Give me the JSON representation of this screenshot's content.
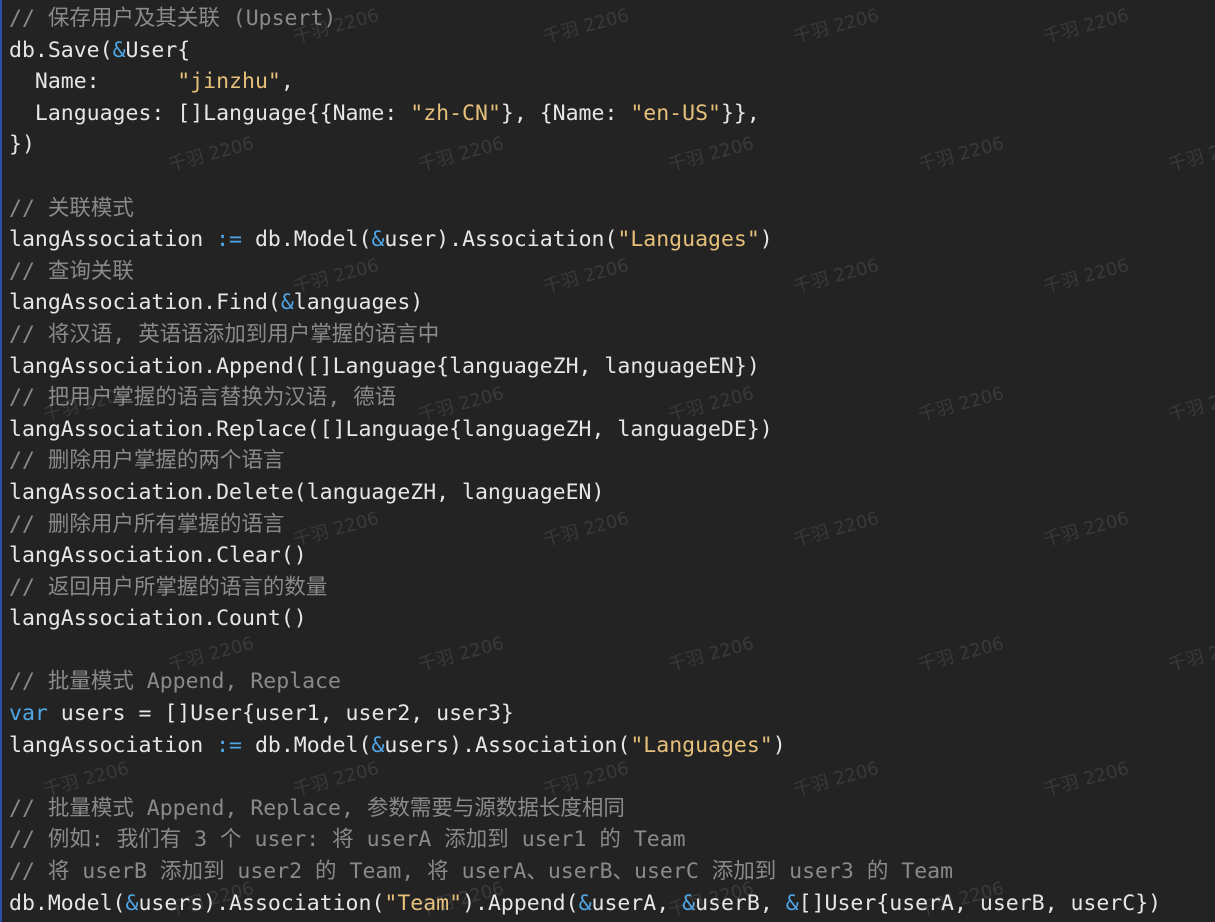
{
  "colors": {
    "background": "#232323",
    "comment": "#8a8a8a",
    "string": "#e6c07b",
    "keyword": "#4fa6e6",
    "text": "#e6e6e6"
  },
  "watermark_text": "千羽 2206",
  "lines": [
    [
      {
        "t": "// 保存用户及其关联 (Upsert)",
        "c": "comment"
      }
    ],
    [
      {
        "t": "db.Save(",
        "c": "plain"
      },
      {
        "t": "&",
        "c": "op"
      },
      {
        "t": "User{",
        "c": "plain"
      }
    ],
    [
      {
        "t": "  Name:      ",
        "c": "plain"
      },
      {
        "t": "\"jinzhu\"",
        "c": "string"
      },
      {
        "t": ",",
        "c": "plain"
      }
    ],
    [
      {
        "t": "  Languages: []Language{{Name: ",
        "c": "plain"
      },
      {
        "t": "\"zh-CN\"",
        "c": "string"
      },
      {
        "t": "}, {Name: ",
        "c": "plain"
      },
      {
        "t": "\"en-US\"",
        "c": "string"
      },
      {
        "t": "}},",
        "c": "plain"
      }
    ],
    [
      {
        "t": "})",
        "c": "plain"
      }
    ],
    [
      {
        "t": "",
        "c": "plain"
      }
    ],
    [
      {
        "t": "// 关联模式",
        "c": "comment"
      }
    ],
    [
      {
        "t": "langAssociation ",
        "c": "plain"
      },
      {
        "t": ":=",
        "c": "op"
      },
      {
        "t": " db.Model(",
        "c": "plain"
      },
      {
        "t": "&",
        "c": "op"
      },
      {
        "t": "user).Association(",
        "c": "plain"
      },
      {
        "t": "\"Languages\"",
        "c": "string"
      },
      {
        "t": ")",
        "c": "plain"
      }
    ],
    [
      {
        "t": "// 查询关联",
        "c": "comment"
      }
    ],
    [
      {
        "t": "langAssociation.Find(",
        "c": "plain"
      },
      {
        "t": "&",
        "c": "op"
      },
      {
        "t": "languages)",
        "c": "plain"
      }
    ],
    [
      {
        "t": "// 将汉语, 英语语添加到用户掌握的语言中",
        "c": "comment"
      }
    ],
    [
      {
        "t": "langAssociation.Append([]Language{languageZH, languageEN})",
        "c": "plain"
      }
    ],
    [
      {
        "t": "// 把用户掌握的语言替换为汉语, 德语",
        "c": "comment"
      }
    ],
    [
      {
        "t": "langAssociation.Replace([]Language{languageZH, languageDE})",
        "c": "plain"
      }
    ],
    [
      {
        "t": "// 删除用户掌握的两个语言",
        "c": "comment"
      }
    ],
    [
      {
        "t": "langAssociation.Delete(languageZH, languageEN)",
        "c": "plain"
      }
    ],
    [
      {
        "t": "// 删除用户所有掌握的语言",
        "c": "comment"
      }
    ],
    [
      {
        "t": "langAssociation.Clear()",
        "c": "plain"
      }
    ],
    [
      {
        "t": "// 返回用户所掌握的语言的数量",
        "c": "comment"
      }
    ],
    [
      {
        "t": "langAssociation.Count()",
        "c": "plain"
      }
    ],
    [
      {
        "t": "",
        "c": "plain"
      }
    ],
    [
      {
        "t": "// 批量模式 Append, Replace",
        "c": "comment"
      }
    ],
    [
      {
        "t": "var",
        "c": "keyword"
      },
      {
        "t": " users = []User{user1, user2, user3}",
        "c": "plain"
      }
    ],
    [
      {
        "t": "langAssociation ",
        "c": "plain"
      },
      {
        "t": ":=",
        "c": "op"
      },
      {
        "t": " db.Model(",
        "c": "plain"
      },
      {
        "t": "&",
        "c": "op"
      },
      {
        "t": "users).Association(",
        "c": "plain"
      },
      {
        "t": "\"Languages\"",
        "c": "string"
      },
      {
        "t": ")",
        "c": "plain"
      }
    ],
    [
      {
        "t": "",
        "c": "plain"
      }
    ],
    [
      {
        "t": "// 批量模式 Append, Replace, 参数需要与源数据长度相同",
        "c": "comment"
      }
    ],
    [
      {
        "t": "// 例如: 我们有 3 个 user: 将 userA 添加到 user1 的 Team",
        "c": "comment"
      }
    ],
    [
      {
        "t": "// 将 userB 添加到 user2 的 Team, 将 userA、userB、userC 添加到 user3 的 Team",
        "c": "comment"
      }
    ],
    [
      {
        "t": "db.Model(",
        "c": "plain"
      },
      {
        "t": "&",
        "c": "op"
      },
      {
        "t": "users).Association(",
        "c": "plain"
      },
      {
        "t": "\"Team\"",
        "c": "string"
      },
      {
        "t": ").Append(",
        "c": "plain"
      },
      {
        "t": "&",
        "c": "op"
      },
      {
        "t": "userA, ",
        "c": "plain"
      },
      {
        "t": "&",
        "c": "op"
      },
      {
        "t": "userB, ",
        "c": "plain"
      },
      {
        "t": "&",
        "c": "op"
      },
      {
        "t": "[]User{userA, userB, userC})",
        "c": "plain"
      }
    ]
  ]
}
